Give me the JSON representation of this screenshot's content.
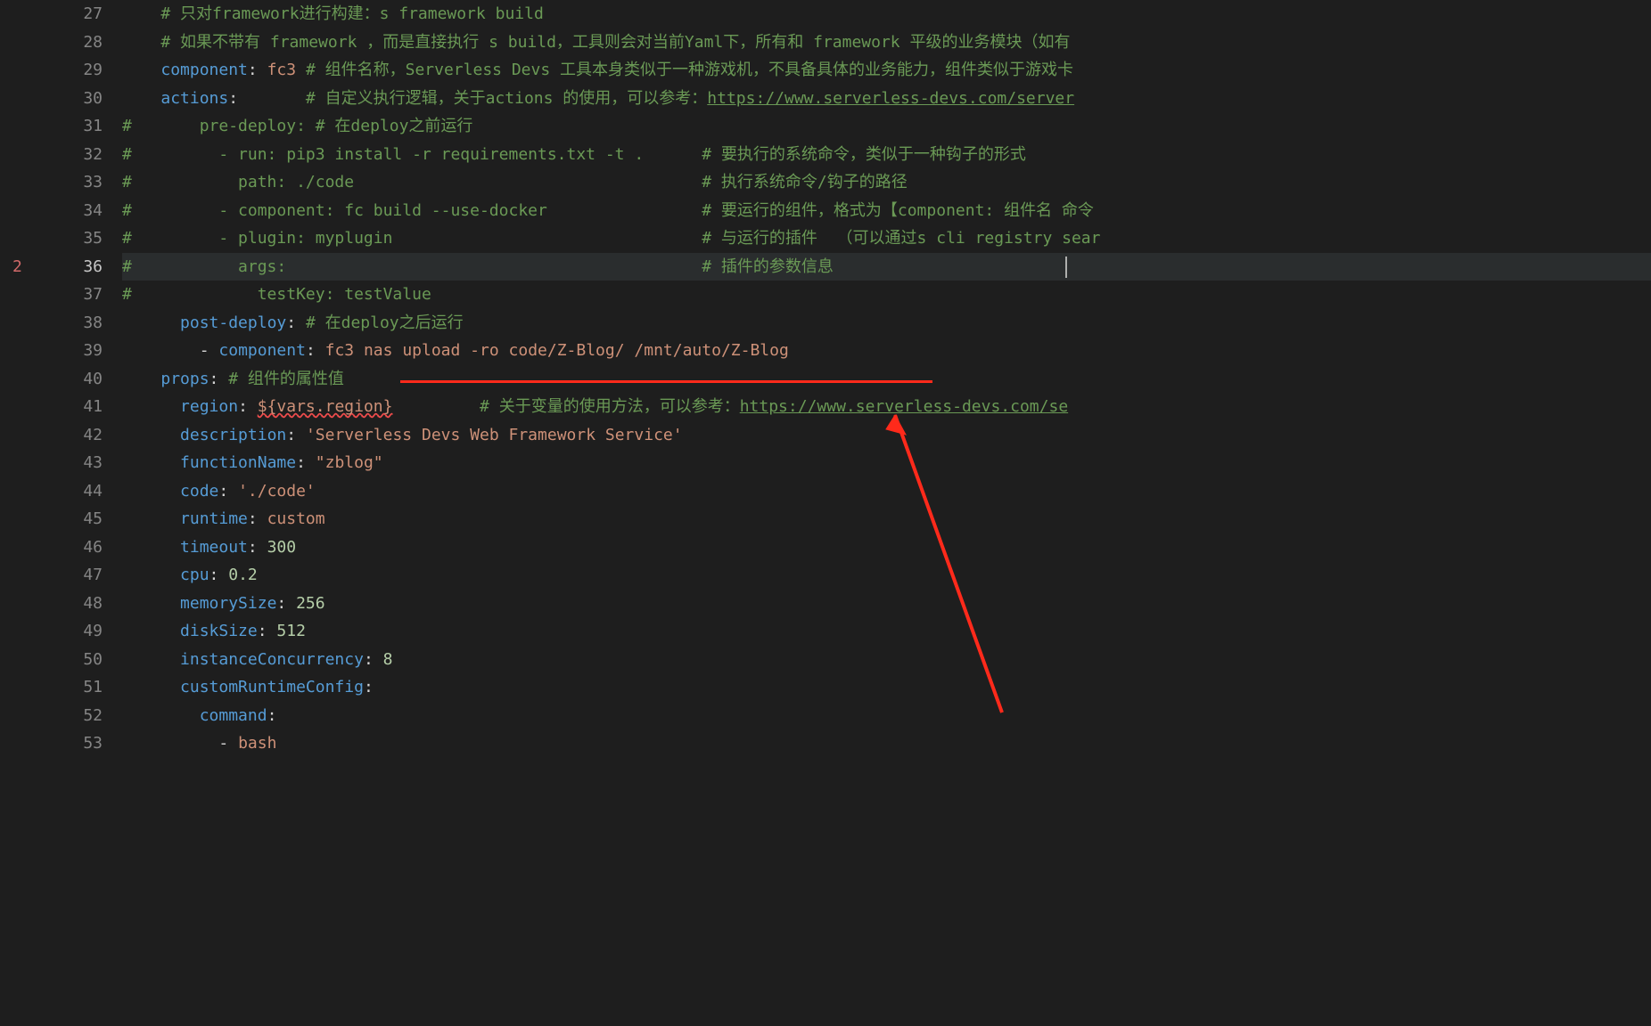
{
  "error_badge": "2",
  "first_line_no": 27,
  "current_line_no": 36,
  "lines": [
    {
      "tokens": [
        {
          "t": "    ",
          "cls": ""
        },
        {
          "t": "# 只对framework进行构建：s framework build",
          "cls": "c"
        }
      ]
    },
    {
      "tokens": [
        {
          "t": "    ",
          "cls": ""
        },
        {
          "t": "# 如果不带有 framework ，而是直接执行 s build，工具则会对当前Yaml下，所有和 framework 平级的业务模块（如有",
          "cls": "c"
        }
      ]
    },
    {
      "tokens": [
        {
          "t": "    ",
          "cls": ""
        },
        {
          "t": "component",
          "cls": "k"
        },
        {
          "t": ": ",
          "cls": "p"
        },
        {
          "t": "fc3",
          "cls": "s"
        },
        {
          "t": " ",
          "cls": ""
        },
        {
          "t": "# 组件名称，Serverless Devs 工具本身类似于一种游戏机，不具备具体的业务能力，组件类似于游戏卡",
          "cls": "c"
        }
      ]
    },
    {
      "tokens": [
        {
          "t": "    ",
          "cls": ""
        },
        {
          "t": "actions",
          "cls": "k"
        },
        {
          "t": ":",
          "cls": "p"
        },
        {
          "t": "       ",
          "cls": ""
        },
        {
          "t": "# 自定义执行逻辑，关于actions 的使用，可以参考：",
          "cls": "c"
        },
        {
          "t": "https://www.serverless-devs.com/server",
          "cls": "c u"
        }
      ]
    },
    {
      "tokens": [
        {
          "t": "",
          "cls": ""
        },
        {
          "t": "#       pre-deploy: # 在deploy之前运行",
          "cls": "c"
        }
      ]
    },
    {
      "tokens": [
        {
          "t": "",
          "cls": ""
        },
        {
          "t": "#         - run: pip3 install -r requirements.txt -t .      # 要执行的系统命令，类似于一种钩子的形式",
          "cls": "c"
        }
      ]
    },
    {
      "tokens": [
        {
          "t": "",
          "cls": ""
        },
        {
          "t": "#           path: ./code                                    # 执行系统命令/钩子的路径",
          "cls": "c"
        }
      ]
    },
    {
      "tokens": [
        {
          "t": "",
          "cls": ""
        },
        {
          "t": "#         - component: fc build --use-docker                # 要运行的组件，格式为【component: 组件名 命令",
          "cls": "c"
        }
      ]
    },
    {
      "tokens": [
        {
          "t": "",
          "cls": ""
        },
        {
          "t": "#         - plugin: myplugin                                # 与运行的插件  （可以通过s cli registry sear",
          "cls": "c"
        }
      ]
    },
    {
      "hl": true,
      "tokens": [
        {
          "t": "",
          "cls": ""
        },
        {
          "t": "#           args:                                           # 插件的参数信息",
          "cls": "c"
        }
      ]
    },
    {
      "tokens": [
        {
          "t": "",
          "cls": ""
        },
        {
          "t": "#             testKey: testValue",
          "cls": "c"
        }
      ]
    },
    {
      "tokens": [
        {
          "t": "      ",
          "cls": ""
        },
        {
          "t": "post-deploy",
          "cls": "k"
        },
        {
          "t": ": ",
          "cls": "p"
        },
        {
          "t": "# 在deploy之后运行",
          "cls": "c"
        }
      ]
    },
    {
      "tokens": [
        {
          "t": "        ",
          "cls": ""
        },
        {
          "t": "- ",
          "cls": "p"
        },
        {
          "t": "component",
          "cls": "k"
        },
        {
          "t": ": ",
          "cls": "p"
        },
        {
          "t": "fc3 nas upload -ro code/Z-Blog/ /mnt/auto/Z-Blog",
          "cls": "s"
        }
      ]
    },
    {
      "tokens": [
        {
          "t": "    ",
          "cls": ""
        },
        {
          "t": "props",
          "cls": "k"
        },
        {
          "t": ": ",
          "cls": "p"
        },
        {
          "t": "# 组件的属性值",
          "cls": "c"
        }
      ]
    },
    {
      "tokens": [
        {
          "t": "      ",
          "cls": ""
        },
        {
          "t": "region",
          "cls": "k"
        },
        {
          "t": ": ",
          "cls": "p"
        },
        {
          "t": "${vars.region}",
          "cls": "s err-underline"
        },
        {
          "t": "         ",
          "cls": ""
        },
        {
          "t": "# 关于变量的使用方法，可以参考：",
          "cls": "c"
        },
        {
          "t": "https://www.serverless-devs.com/se",
          "cls": "c u"
        }
      ]
    },
    {
      "tokens": [
        {
          "t": "      ",
          "cls": ""
        },
        {
          "t": "description",
          "cls": "k"
        },
        {
          "t": ": ",
          "cls": "p"
        },
        {
          "t": "'Serverless Devs Web Framework Service'",
          "cls": "s"
        }
      ]
    },
    {
      "tokens": [
        {
          "t": "      ",
          "cls": ""
        },
        {
          "t": "functionName",
          "cls": "k"
        },
        {
          "t": ": ",
          "cls": "p"
        },
        {
          "t": "\"zblog\"",
          "cls": "s"
        }
      ]
    },
    {
      "tokens": [
        {
          "t": "      ",
          "cls": ""
        },
        {
          "t": "code",
          "cls": "k"
        },
        {
          "t": ": ",
          "cls": "p"
        },
        {
          "t": "'./code'",
          "cls": "s"
        }
      ]
    },
    {
      "tokens": [
        {
          "t": "      ",
          "cls": ""
        },
        {
          "t": "runtime",
          "cls": "k"
        },
        {
          "t": ": ",
          "cls": "p"
        },
        {
          "t": "custom",
          "cls": "s"
        }
      ]
    },
    {
      "tokens": [
        {
          "t": "      ",
          "cls": ""
        },
        {
          "t": "timeout",
          "cls": "k"
        },
        {
          "t": ": ",
          "cls": "p"
        },
        {
          "t": "300",
          "cls": "n"
        }
      ]
    },
    {
      "tokens": [
        {
          "t": "      ",
          "cls": ""
        },
        {
          "t": "cpu",
          "cls": "k"
        },
        {
          "t": ": ",
          "cls": "p"
        },
        {
          "t": "0.2",
          "cls": "n"
        }
      ]
    },
    {
      "tokens": [
        {
          "t": "      ",
          "cls": ""
        },
        {
          "t": "memorySize",
          "cls": "k"
        },
        {
          "t": ": ",
          "cls": "p"
        },
        {
          "t": "256",
          "cls": "n"
        }
      ]
    },
    {
      "tokens": [
        {
          "t": "      ",
          "cls": ""
        },
        {
          "t": "diskSize",
          "cls": "k"
        },
        {
          "t": ": ",
          "cls": "p"
        },
        {
          "t": "512",
          "cls": "n"
        }
      ]
    },
    {
      "tokens": [
        {
          "t": "      ",
          "cls": ""
        },
        {
          "t": "instanceConcurrency",
          "cls": "k"
        },
        {
          "t": ": ",
          "cls": "p"
        },
        {
          "t": "8",
          "cls": "n"
        }
      ]
    },
    {
      "tokens": [
        {
          "t": "      ",
          "cls": ""
        },
        {
          "t": "customRuntimeConfig",
          "cls": "k"
        },
        {
          "t": ":",
          "cls": "p"
        }
      ]
    },
    {
      "tokens": [
        {
          "t": "        ",
          "cls": ""
        },
        {
          "t": "command",
          "cls": "k"
        },
        {
          "t": ":",
          "cls": "p"
        }
      ]
    },
    {
      "tokens": [
        {
          "t": "          ",
          "cls": ""
        },
        {
          "t": "- ",
          "cls": "p"
        },
        {
          "t": "bash",
          "cls": "s"
        }
      ]
    }
  ]
}
